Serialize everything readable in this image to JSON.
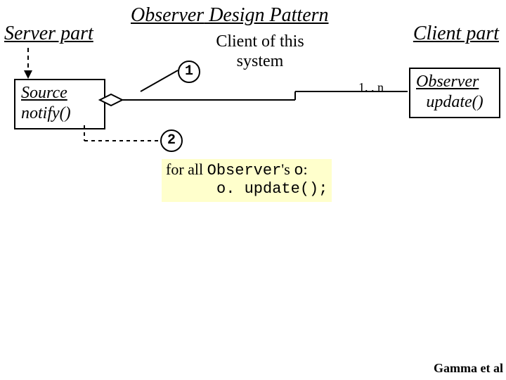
{
  "title_italic": "Observer",
  "title_rest": " Design Pattern",
  "server_part": "Server part",
  "client_part": "Client part",
  "client_of_this_l1": "Client of this",
  "client_of_this_l2": "system",
  "circle1": "1",
  "circle2": "2",
  "multiplicity": "1. . n",
  "source": {
    "name": "Source",
    "method": "notify()"
  },
  "observer": {
    "name": "Observer",
    "method": "update()"
  },
  "note": {
    "prefix": "for all ",
    "mono1": "Observer",
    "mid": "'s ",
    "mono2": "o",
    "colon": ":",
    "line2": "o. update();"
  },
  "credit": "Gamma et al"
}
